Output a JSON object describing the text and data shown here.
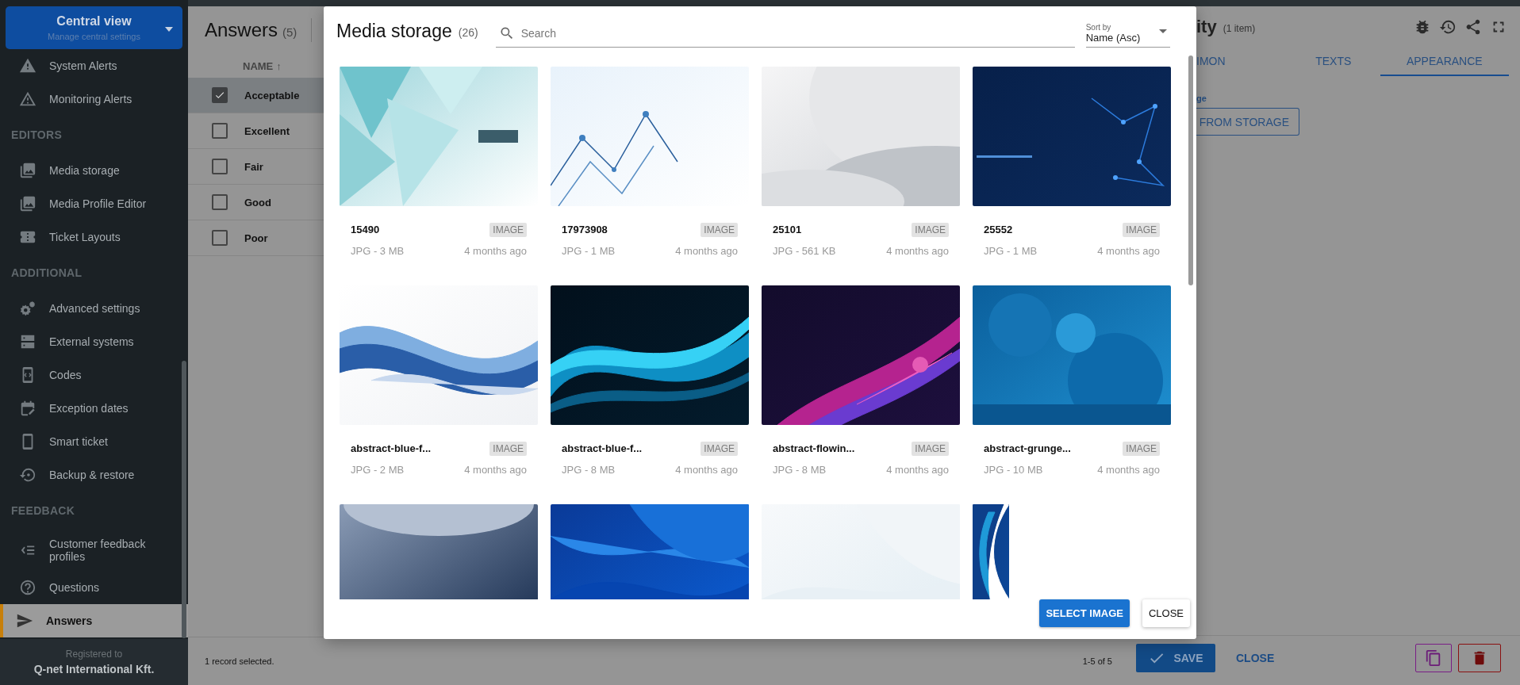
{
  "sidebar": {
    "header": {
      "title": "Central view",
      "subtitle": "Manage central settings"
    },
    "sections": [
      {
        "items": [
          {
            "label": "System Alerts",
            "selected": false
          },
          {
            "label": "Monitoring Alerts",
            "selected": false
          }
        ]
      },
      {
        "title": "EDITORS",
        "items": [
          {
            "label": "Media storage",
            "selected": false
          },
          {
            "label": "Media Profile Editor",
            "selected": false
          },
          {
            "label": "Ticket Layouts",
            "selected": false
          }
        ]
      },
      {
        "title": "ADDITIONAL",
        "items": [
          {
            "label": "Advanced settings",
            "selected": false
          },
          {
            "label": "External systems",
            "selected": false
          },
          {
            "label": "Codes",
            "selected": false
          },
          {
            "label": "Exception dates",
            "selected": false
          },
          {
            "label": "Smart ticket",
            "selected": false
          },
          {
            "label": "Backup & restore",
            "selected": false
          }
        ]
      },
      {
        "title": "FEEDBACK",
        "items": [
          {
            "label": "Customer feedback profiles",
            "selected": false
          },
          {
            "label": "Questions",
            "selected": false
          },
          {
            "label": "Answers",
            "selected": true
          }
        ]
      }
    ],
    "footer": {
      "caption": "Registered to",
      "owner": "Q-net International Kft."
    }
  },
  "list": {
    "title": "Answers",
    "count": "(5)",
    "column": "NAME",
    "sort_icon": "↑",
    "rows": [
      {
        "name": "Acceptable",
        "checked": true,
        "selected": true
      },
      {
        "name": "Excellent",
        "checked": false,
        "selected": false
      },
      {
        "name": "Fair",
        "checked": false,
        "selected": false
      },
      {
        "name": "Good",
        "checked": false,
        "selected": false
      },
      {
        "name": "Poor",
        "checked": false,
        "selected": false
      }
    ],
    "status": "1 record selected.",
    "pagination": "1-5 of 5"
  },
  "detail": {
    "title": "ity",
    "count": "(1 item)",
    "tabs": [
      {
        "label": "IMON",
        "selected": false
      },
      {
        "label": "TEXTS",
        "selected": false
      },
      {
        "label": "APPEARANCE",
        "selected": true
      }
    ],
    "field_label": "ge",
    "storage_button": "FROM STORAGE",
    "save_button": "SAVE",
    "close_button": "CLOSE"
  },
  "dialog": {
    "title": "Media storage",
    "count": "(26)",
    "search": {
      "placeholder": "Search"
    },
    "sort": {
      "label": "Sort by",
      "value": "Name (Asc)"
    },
    "items": [
      {
        "kind": "file",
        "name": "15490",
        "type": "IMAGE",
        "info": "JPG - 3 MB",
        "age": "4 months ago"
      },
      {
        "kind": "file",
        "name": "17973908",
        "type": "IMAGE",
        "info": "JPG - 1 MB",
        "age": "4 months ago"
      },
      {
        "kind": "file",
        "name": "25101",
        "type": "IMAGE",
        "info": "JPG - 561 KB",
        "age": "4 months ago"
      },
      {
        "kind": "file",
        "name": "25552",
        "type": "IMAGE",
        "info": "JPG - 1 MB",
        "age": "4 months ago"
      },
      {
        "kind": "file",
        "name": "abstract-blue-f...",
        "type": "IMAGE",
        "info": "JPG - 2 MB",
        "age": "4 months ago"
      },
      {
        "kind": "file",
        "name": "abstract-blue-f...",
        "type": "IMAGE",
        "info": "JPG - 8 MB",
        "age": "4 months ago"
      },
      {
        "kind": "file",
        "name": "abstract-flowin...",
        "type": "IMAGE",
        "info": "JPG - 8 MB",
        "age": "4 months ago"
      },
      {
        "kind": "file",
        "name": "abstract-grunge...",
        "type": "IMAGE",
        "info": "JPG - 10 MB",
        "age": "4 months ago"
      },
      {
        "kind": "picture"
      },
      {
        "kind": "picture"
      },
      {
        "kind": "picture"
      },
      {
        "kind": "picture"
      }
    ],
    "select_button": "SELECT IMAGE",
    "close_button": "CLOSE"
  }
}
